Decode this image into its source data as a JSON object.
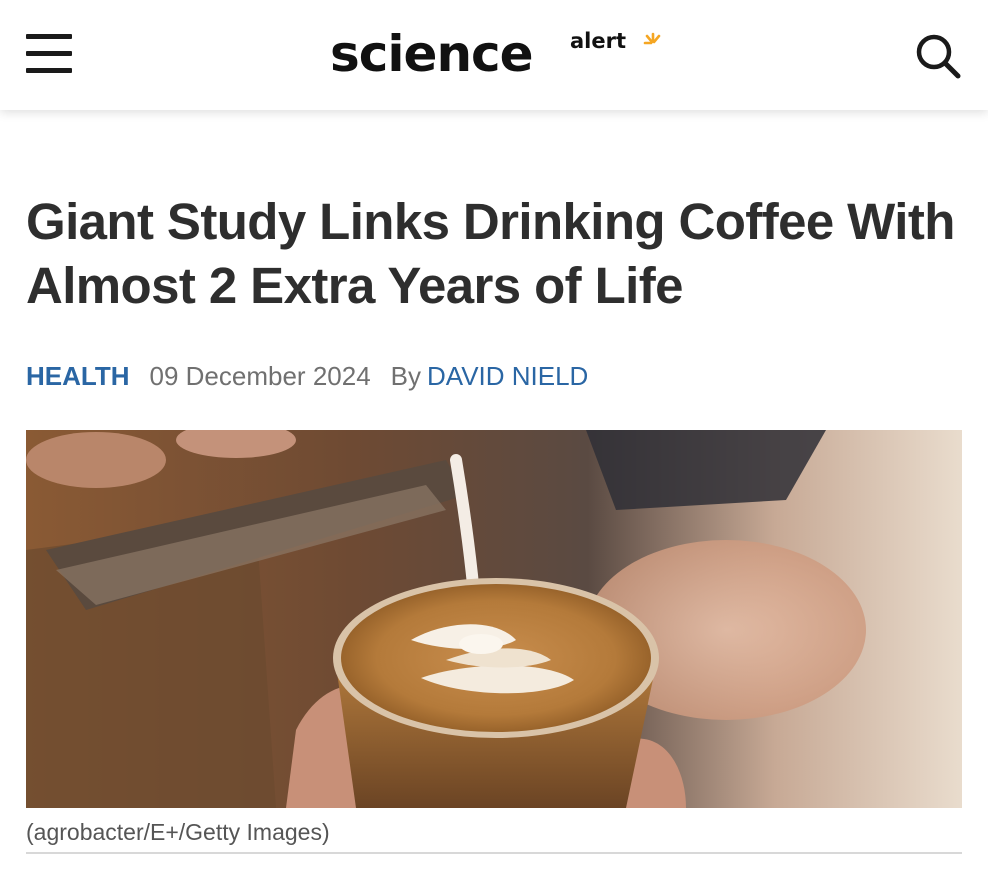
{
  "header": {
    "logo": {
      "main": "science",
      "sub": "alert",
      "accent_color": "#F5A623"
    },
    "menu_icon": "hamburger-menu-icon",
    "search_icon": "search-icon"
  },
  "article": {
    "headline": "Giant Study Links Drinking Coffee With Almost 2 Extra Years of Life",
    "category": "HEALTH",
    "date": "09 December 2024",
    "by_label": "By",
    "author": "DAVID NIELD",
    "image_caption": "(agrobacter/E+/Getty Images)"
  },
  "colors": {
    "link_blue": "#2A66A4",
    "headline_text": "#2E2E2E",
    "meta_gray": "#707070"
  }
}
